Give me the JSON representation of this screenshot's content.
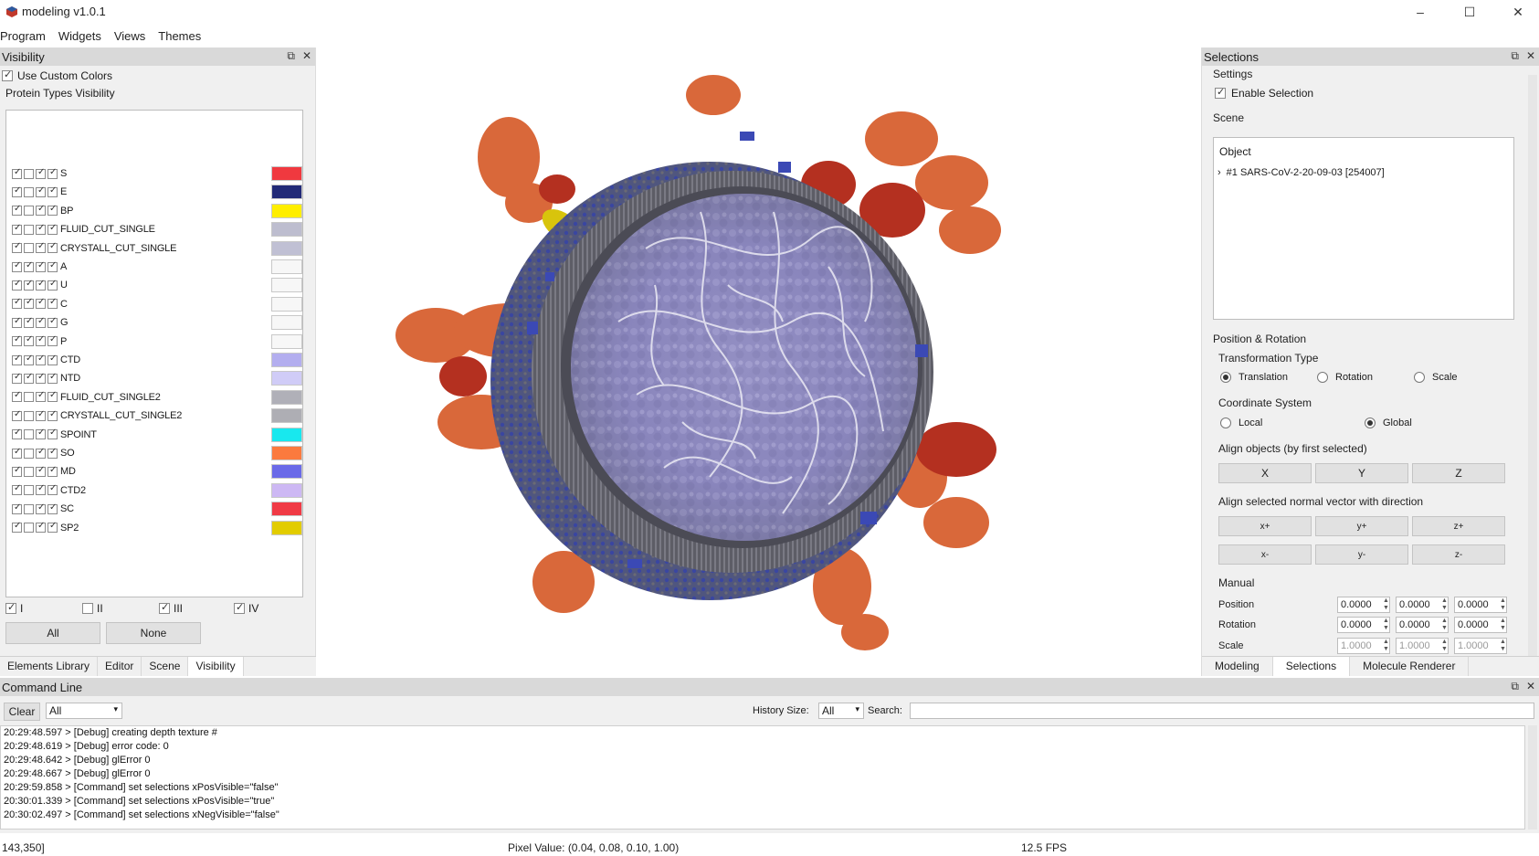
{
  "window": {
    "title": "modeling v1.0.1",
    "minimize": "–",
    "maximize": "☐",
    "close": "✕"
  },
  "menubar": {
    "items": [
      "Program",
      "Widgets",
      "Views",
      "Themes"
    ]
  },
  "visibility": {
    "dock_title": "Visibility",
    "use_custom_colors": "Use Custom Colors",
    "protein_types_label": "Protein Types Visibility",
    "proteins": [
      {
        "name": "S",
        "color": "#f0393f",
        "checks": [
          true,
          false,
          true,
          true
        ]
      },
      {
        "name": "E",
        "color": "#222a78",
        "checks": [
          true,
          false,
          true,
          true
        ]
      },
      {
        "name": "BP",
        "color": "#ffee00",
        "checks": [
          true,
          false,
          true,
          true
        ]
      },
      {
        "name": "FLUID_CUT_SINGLE",
        "color": "#bdbdcf",
        "checks": [
          true,
          false,
          true,
          true
        ]
      },
      {
        "name": "CRYSTALL_CUT_SINGLE",
        "color": "#c0c0d4",
        "checks": [
          true,
          false,
          true,
          true
        ]
      },
      {
        "name": "A",
        "color": "#f7f7f7",
        "checks": [
          true,
          true,
          true,
          true
        ]
      },
      {
        "name": "U",
        "color": "#f7f7f7",
        "checks": [
          true,
          true,
          true,
          true
        ]
      },
      {
        "name": "C",
        "color": "#f7f7f7",
        "checks": [
          true,
          true,
          true,
          true
        ]
      },
      {
        "name": "G",
        "color": "#f7f7f7",
        "checks": [
          true,
          true,
          true,
          true
        ]
      },
      {
        "name": "P",
        "color": "#f7f7f7",
        "checks": [
          true,
          true,
          true,
          true
        ]
      },
      {
        "name": "CTD",
        "color": "#b3aeef",
        "checks": [
          true,
          true,
          true,
          true
        ]
      },
      {
        "name": "NTD",
        "color": "#d0ccf7",
        "checks": [
          true,
          true,
          true,
          true
        ]
      },
      {
        "name": "FLUID_CUT_SINGLE2",
        "color": "#b0b0b8",
        "checks": [
          true,
          false,
          true,
          true
        ]
      },
      {
        "name": "CRYSTALL_CUT_SINGLE2",
        "color": "#aeaeb4",
        "checks": [
          true,
          false,
          true,
          true
        ]
      },
      {
        "name": "SPOINT",
        "color": "#18e8ee",
        "checks": [
          true,
          false,
          true,
          true
        ]
      },
      {
        "name": "SO",
        "color": "#fb7a3e",
        "checks": [
          true,
          false,
          true,
          true
        ]
      },
      {
        "name": "MD",
        "color": "#6a6ae8",
        "checks": [
          true,
          false,
          true,
          true
        ]
      },
      {
        "name": "CTD2",
        "color": "#cdb8f4",
        "checks": [
          true,
          false,
          true,
          true
        ]
      },
      {
        "name": "SC",
        "color": "#f03a45",
        "checks": [
          true,
          false,
          true,
          true
        ]
      },
      {
        "name": "SP2",
        "color": "#e2cc00",
        "checks": [
          true,
          false,
          true,
          true
        ]
      }
    ],
    "groups": [
      {
        "label": "I",
        "checked": true
      },
      {
        "label": "II",
        "checked": false
      },
      {
        "label": "III",
        "checked": true
      },
      {
        "label": "IV",
        "checked": true
      }
    ],
    "all_button": "All",
    "none_button": "None",
    "tabs": [
      "Elements Library",
      "Editor",
      "Scene",
      "Visibility"
    ]
  },
  "selections": {
    "dock_title": "Selections",
    "settings_label": "Settings",
    "enable_selection": "Enable Selection",
    "scene_label": "Scene",
    "object_header": "Object",
    "object_item": "#1 SARS-CoV-2-20-09-03 [254007]",
    "position_rotation_label": "Position & Rotation",
    "transformation_type_label": "Transformation Type",
    "transformation_types": [
      "Translation",
      "Rotation",
      "Scale"
    ],
    "coordinate_system_label": "Coordinate System",
    "coordinate_systems": [
      "Local",
      "Global"
    ],
    "align_objects_label": "Align objects (by first selected)",
    "align_axes": [
      "X",
      "Y",
      "Z"
    ],
    "align_normal_label": "Align selected normal vector with direction",
    "direction_pos": [
      "x+",
      "y+",
      "z+"
    ],
    "direction_neg": [
      "x-",
      "y-",
      "z-"
    ],
    "manual_label": "Manual",
    "position_label": "Position",
    "rotation_label": "Rotation",
    "scale_label": "Scale",
    "position_values": [
      "0.0000",
      "0.0000",
      "0.0000"
    ],
    "rotation_values": [
      "0.0000",
      "0.0000",
      "0.0000"
    ],
    "scale_values": [
      "1.0000",
      "1.0000",
      "1.0000"
    ],
    "tabs": [
      "Modeling",
      "Selections",
      "Molecule Renderer"
    ]
  },
  "command_line": {
    "dock_title": "Command Line",
    "clear_button": "Clear",
    "filter_value": "All",
    "history_size_label": "History Size:",
    "history_size_value": "All",
    "search_label": "Search:",
    "log": [
      "20:29:48.597 > [Debug] creating depth texture #",
      "20:29:48.619 > [Debug] error code: 0",
      "20:29:48.642 > [Debug] glError 0",
      "20:29:48.667 > [Debug] glError 0",
      "20:29:59.858 > [Command] set selections xPosVisible=\"false\"",
      "20:30:01.339 > [Command] set selections xPosVisible=\"true\"",
      "20:30:02.497 > [Command] set selections xNegVisible=\"false\""
    ]
  },
  "statusbar": {
    "coords": "143,350]",
    "pixel_value": "Pixel Value: (0.04, 0.08, 0.10, 1.00)",
    "fps": "12.5 FPS"
  }
}
